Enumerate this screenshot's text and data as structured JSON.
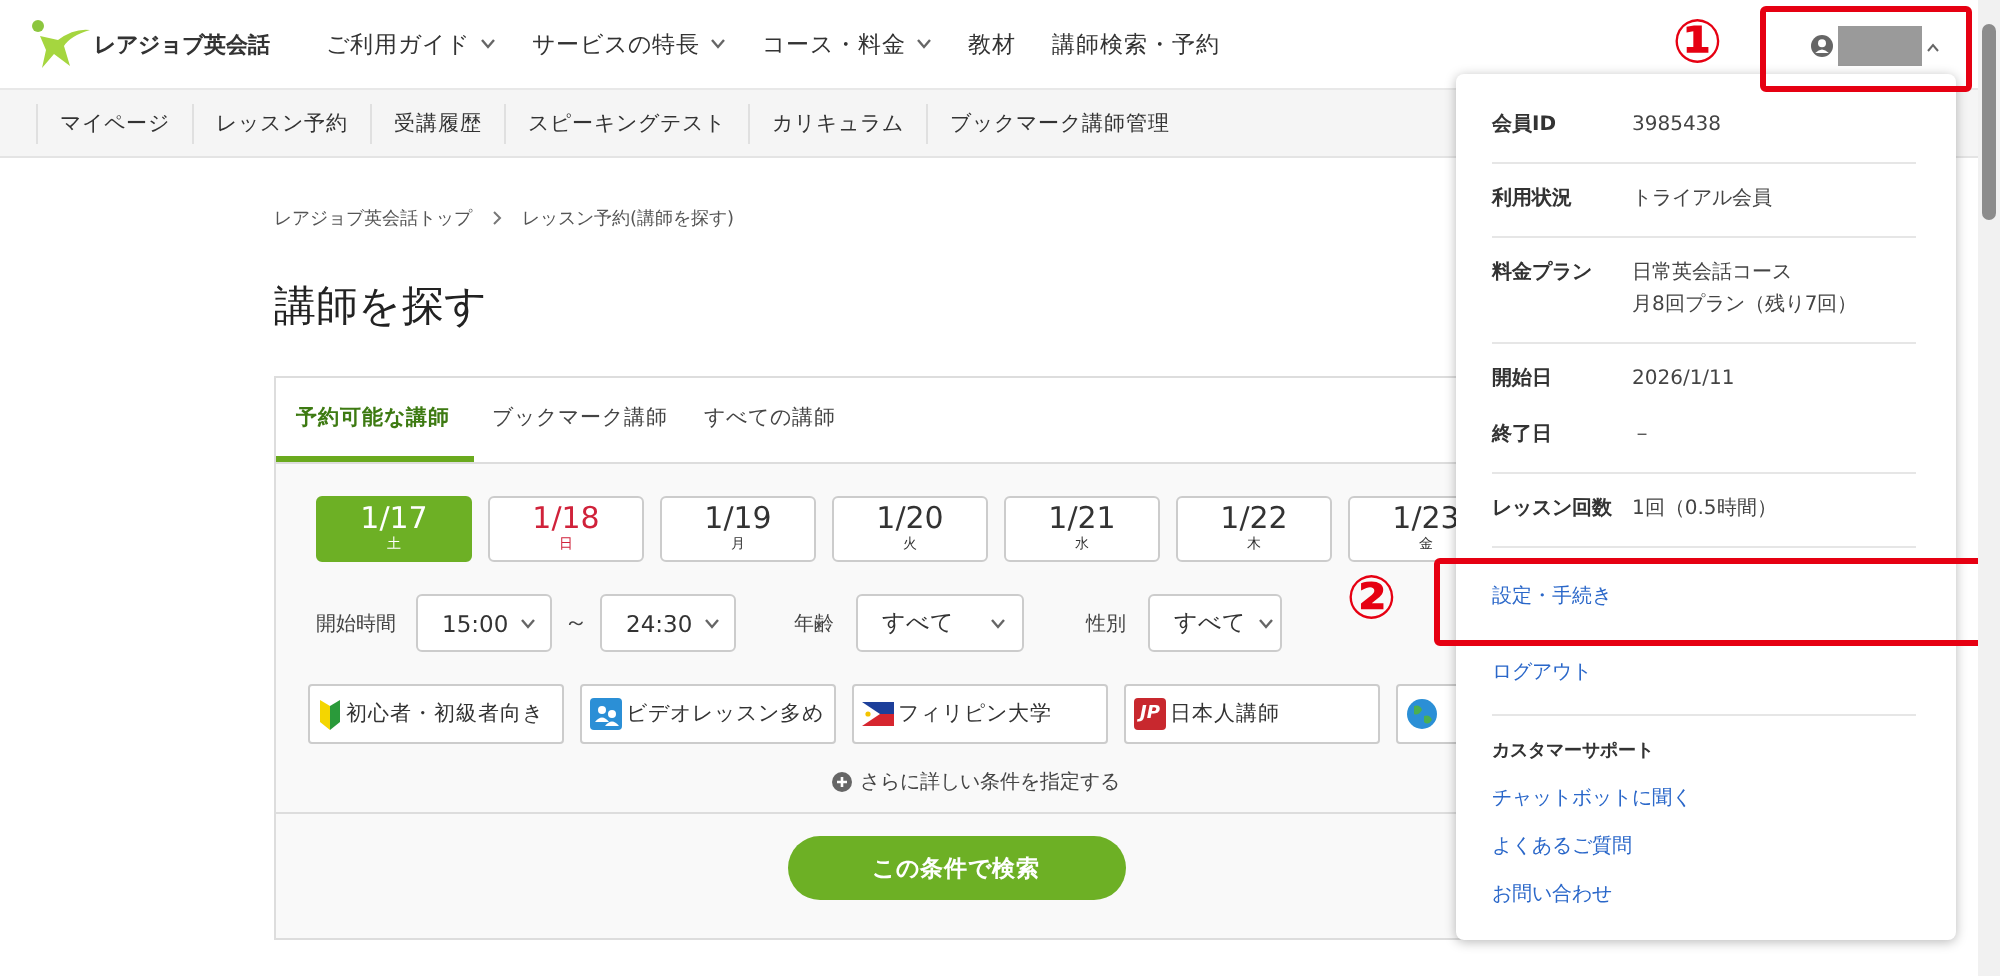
{
  "header": {
    "logo_text": "レアジョブ英会話",
    "nav": [
      {
        "label": "ご利用ガイド",
        "dropdown": true
      },
      {
        "label": "サービスの特長",
        "dropdown": true
      },
      {
        "label": "コース・料金",
        "dropdown": true
      },
      {
        "label": "教材",
        "dropdown": false
      },
      {
        "label": "講師検索・予約",
        "dropdown": false
      }
    ],
    "account": {
      "expanded": true
    }
  },
  "subnav": [
    "マイページ",
    "レッスン予約",
    "受講履歴",
    "スピーキングテスト",
    "カリキュラム",
    "ブックマーク講師管理"
  ],
  "breadcrumb": [
    "レアジョブ英会話トップ",
    "レッスン予約(講師を探す)"
  ],
  "page_title": "講師を探す",
  "tabs": [
    {
      "label": "予約可能な講師",
      "selected": true
    },
    {
      "label": "ブックマーク講師",
      "selected": false
    },
    {
      "label": "すべての講師",
      "selected": false
    }
  ],
  "dates": [
    {
      "date": "1/17",
      "weekday": "土",
      "kind": "weekday",
      "selected": true
    },
    {
      "date": "1/18",
      "weekday": "日",
      "kind": "sunday",
      "selected": false
    },
    {
      "date": "1/19",
      "weekday": "月",
      "kind": "weekday",
      "selected": false
    },
    {
      "date": "1/20",
      "weekday": "火",
      "kind": "weekday",
      "selected": false
    },
    {
      "date": "1/21",
      "weekday": "水",
      "kind": "weekday",
      "selected": false
    },
    {
      "date": "1/22",
      "weekday": "木",
      "kind": "weekday",
      "selected": false
    },
    {
      "date": "1/23",
      "weekday": "金",
      "kind": "weekday",
      "selected": false
    }
  ],
  "filters": {
    "start_time": {
      "label": "開始時間",
      "from": "15:00",
      "separator": "～",
      "to": "24:30"
    },
    "age": {
      "label": "年齢",
      "value": "すべて"
    },
    "gender": {
      "label": "性別",
      "value": "すべて"
    }
  },
  "chips": [
    {
      "label": "初心者・初級者向き",
      "kind": "beginner"
    },
    {
      "label": "ビデオレッスン多め",
      "kind": "video"
    },
    {
      "label": "フィリピン大学",
      "kind": "university"
    },
    {
      "label": "日本人講師",
      "kind": "japanese",
      "badge": "JP"
    },
    {
      "kind": "globe"
    }
  ],
  "more_conditions": "さらに詳しい条件を指定する",
  "search_button": "この条件で検索",
  "account_menu": {
    "groups": [
      [
        {
          "label": "会員ID",
          "value": [
            "3985438"
          ]
        }
      ],
      [
        {
          "label": "利用状況",
          "value": [
            "トライアル会員"
          ]
        }
      ],
      [
        {
          "label": "料金プラン",
          "value": [
            "日常英会話コース",
            "月8回プラン（残り7回）"
          ]
        }
      ],
      [
        {
          "label": "開始日",
          "value": [
            "2026/1/11"
          ]
        },
        {
          "label": "終了日",
          "value": [
            "－"
          ]
        }
      ],
      [
        {
          "label": "レッスン回数",
          "value": [
            "1回（0.5時間）"
          ]
        }
      ]
    ],
    "links": [
      "設定・手続き",
      "ログアウト"
    ],
    "support": {
      "heading": "カスタマーサポート",
      "links": [
        "チャットボットに聞く",
        "よくあるご質問",
        "お問い合わせ"
      ]
    }
  },
  "annotations": [
    {
      "number": "①"
    },
    {
      "number": "②"
    }
  ]
}
